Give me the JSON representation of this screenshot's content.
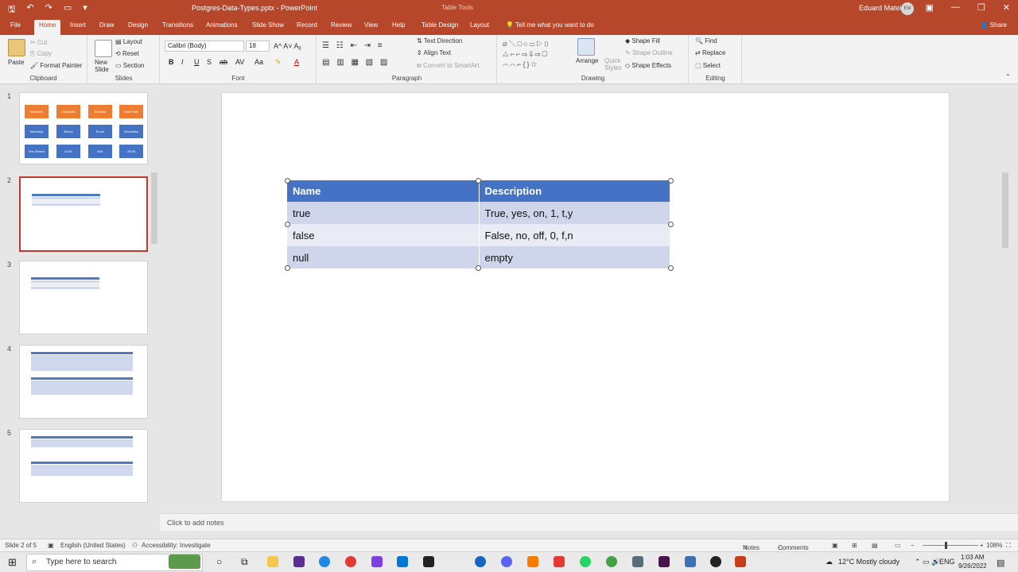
{
  "app": {
    "title": "Postgres-Data-Types.pptx - PowerPoint",
    "table_tools": "Table Tools",
    "user": "Eduard Matei",
    "avatar": "EM"
  },
  "tabs": [
    "File",
    "Home",
    "Insert",
    "Draw",
    "Design",
    "Transitions",
    "Animations",
    "Slide Show",
    "Record",
    "Review",
    "View",
    "Help",
    "Table Design",
    "Layout"
  ],
  "tell_me": "Tell me what you want to do",
  "share": "Share",
  "ribbon": {
    "clipboard": {
      "paste": "Paste",
      "cut": "Cut",
      "copy": "Copy",
      "format_painter": "Format Painter",
      "label": "Clipboard"
    },
    "slides": {
      "new_slide": "New Slide",
      "layout": "Layout",
      "reset": "Reset",
      "section": "Section",
      "label": "Slides"
    },
    "font": {
      "name": "Calibri (Body)",
      "size": "18",
      "label": "Font"
    },
    "paragraph": {
      "text_direction": "Text Direction",
      "align_text": "Align Text",
      "smartart": "Convert to SmartArt",
      "label": "Paragraph"
    },
    "drawing": {
      "arrange": "Arrange",
      "quick_styles": "Quick Styles",
      "shape_fill": "Shape Fill",
      "shape_outline": "Shape Outline",
      "shape_effects": "Shape Effects",
      "label": "Drawing"
    },
    "editing": {
      "find": "Find",
      "replace": "Replace",
      "select": "Select",
      "label": "Editing"
    }
  },
  "thumbnails": {
    "numbers": [
      "1",
      "2",
      "3",
      "4",
      "5"
    ],
    "slide1_boxes": [
      "Numbers",
      "Character",
      "Boolean",
      "Date/Time",
      "Monetary",
      "Binary",
      "Enum",
      "Geometric",
      "Text Search",
      "UUID",
      "XML",
      "JSON"
    ]
  },
  "table": {
    "headers": [
      "Name",
      "Description"
    ],
    "rows": [
      [
        "true",
        "True, yes, on, 1, t,y"
      ],
      [
        "false",
        "False, no, off, 0, f,n"
      ],
      [
        "null",
        "empty"
      ]
    ]
  },
  "notes_placeholder": "Click to add notes",
  "status": {
    "slide": "Slide 2 of 5",
    "language": "English (United States)",
    "accessibility": "Accessibility: Investigate",
    "notes": "Notes",
    "comments": "Comments",
    "zoom": "108%"
  },
  "taskbar": {
    "search_placeholder": "Type here to search",
    "weather": "12°C  Mostly cloudy",
    "lang": "ENG",
    "time": "1:03 AM",
    "date": "9/26/2022"
  },
  "colors": {
    "accent": "#b7472a",
    "table_header": "#4472c4",
    "row_odd": "#cfd5ea",
    "row_even": "#e9ebf5"
  }
}
